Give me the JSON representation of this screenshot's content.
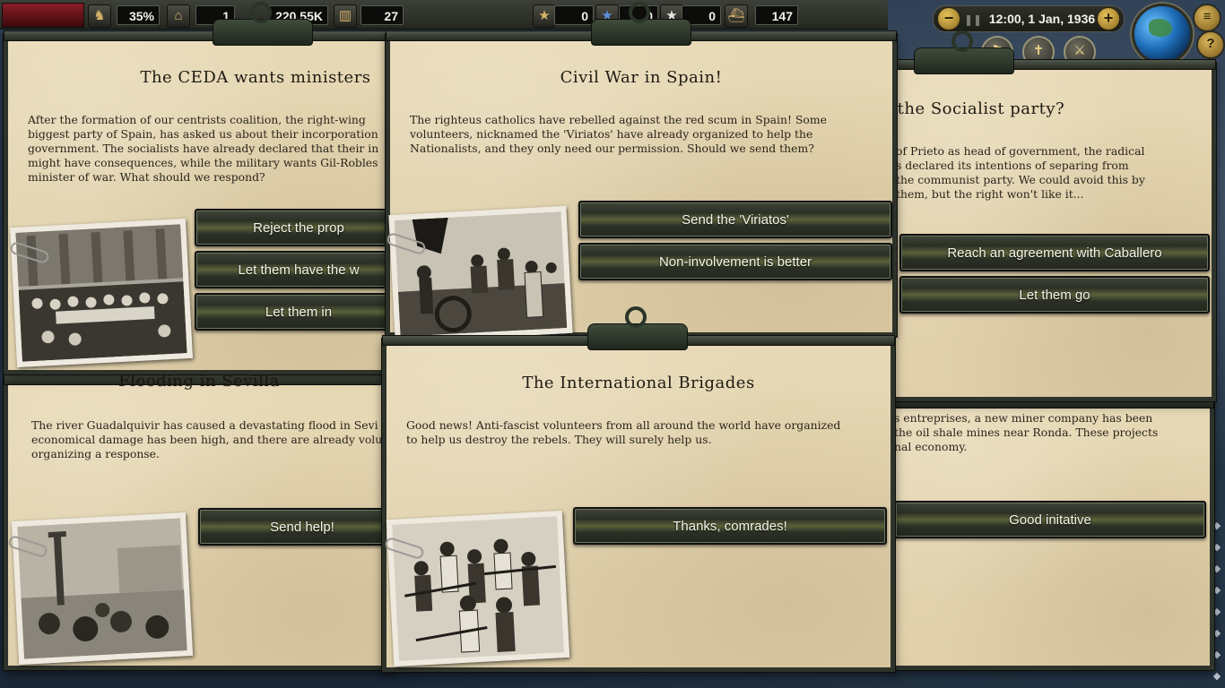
{
  "topbar": {
    "stability": "35%",
    "political_power": "1",
    "manpower": "220.55K",
    "factories": "27",
    "army_experience": "0",
    "navy_experience": "0",
    "air_experience": "0",
    "convoys": "147"
  },
  "date": {
    "text": "12:00, 1 Jan, 1936",
    "speed_down": "−",
    "speed_up": "+"
  },
  "events": [
    {
      "title": "The CEDA wants ministers",
      "desc": "After the formation of our centrists coalition, the right-wing\nbiggest party of Spain, has asked us about their incorporation\ngovernment. The socialists have already declared that their in\nmight have consequences, while the military wants Gil-Robles\nminister of war. What should we respond?",
      "options": [
        "Reject the prop",
        "Let them have the w",
        "Let them in"
      ]
    },
    {
      "title": "Civil War in Spain!",
      "desc": "The righteus catholics have rebelled against the red scum in Spain! Some\nvolunteers, nicknamed the 'Viriatos' have already organized to help the\nNationalists, and they only need our permission. Should we send them?",
      "options": [
        "Send the 'Viriatos'",
        "Non-involvement is better"
      ]
    },
    {
      "title": "k the Socialist party?",
      "desc": "of Prieto as head of government, the radical\ns declared its intentions of separing from\nthe communist party. We could avoid this by\nthem, but the right won't like it...",
      "options": [
        "Reach an agreement with Caballero",
        "Let them go"
      ]
    },
    {
      "title": "Flooding in Sevilla",
      "desc": "The river Guadalquivir has caused a devastating flood in Sevi\neconomical damage has been high, and there are already volu\norganizing a response.",
      "options": [
        "Send help!"
      ]
    },
    {
      "title": "The International Brigades",
      "desc": "Good news! Anti-fascist volunteers from all around the world have organized\nto help us destroy the rebels. They will surely help us.",
      "options": [
        "Thanks, comrades!"
      ]
    },
    {
      "title": "",
      "desc": "s entreprises, a new miner company has been\nthe oil shale mines near Ronda. These projects\nnal economy.",
      "options": [
        "Good initative"
      ]
    }
  ]
}
